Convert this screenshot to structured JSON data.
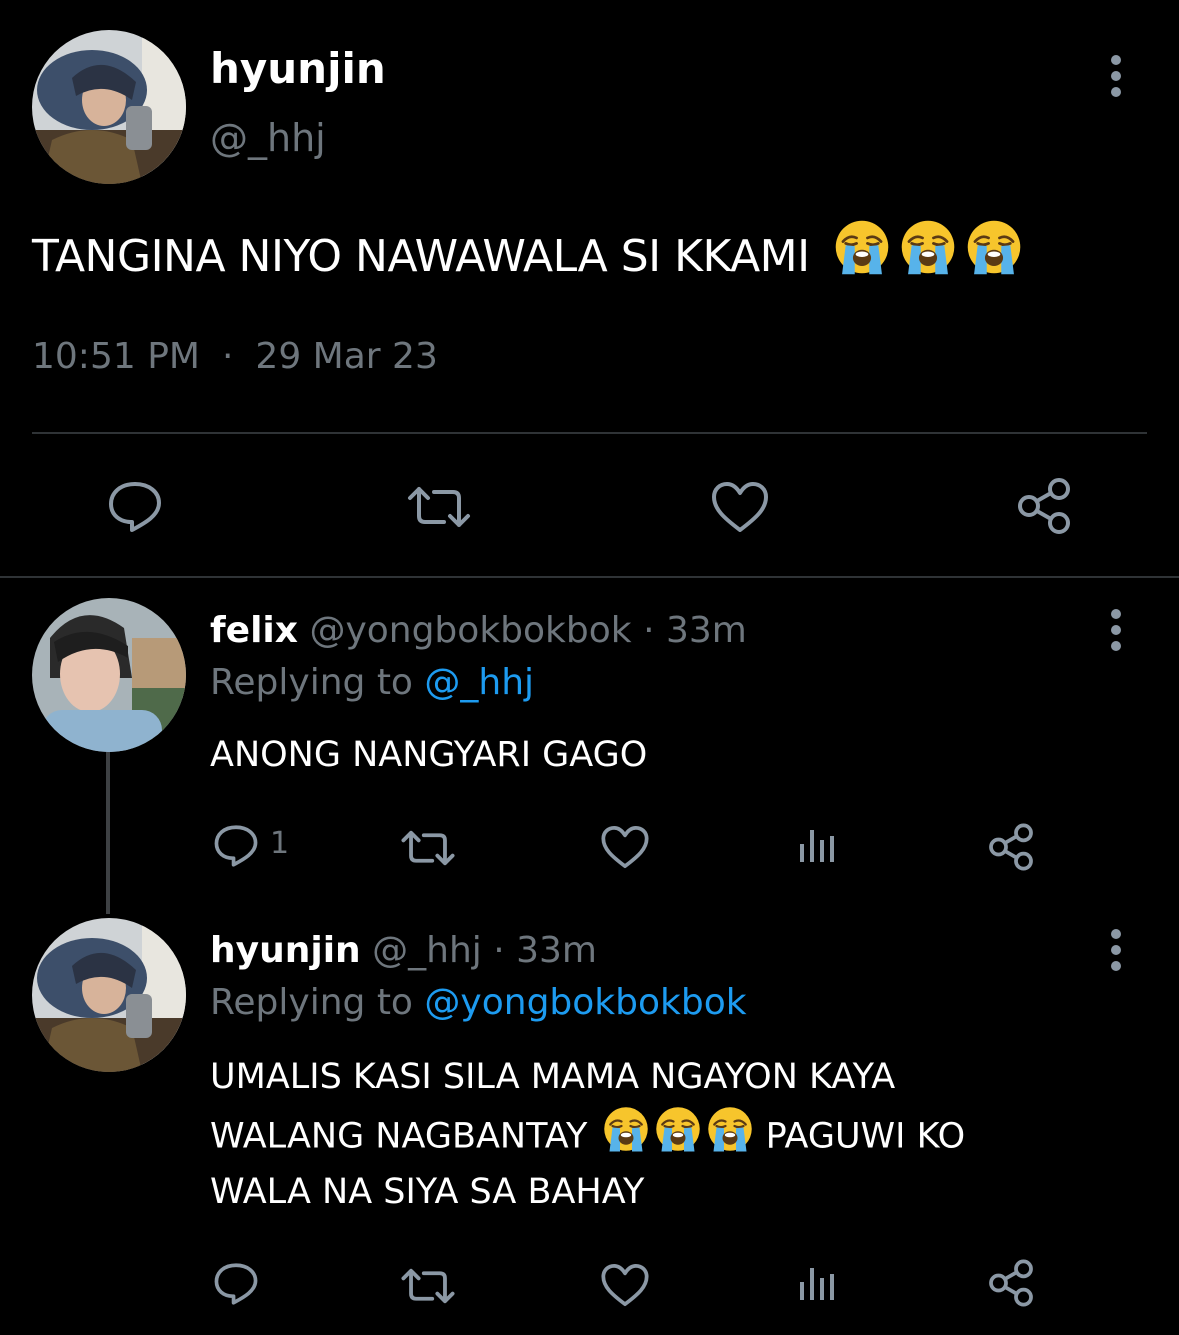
{
  "main_tweet": {
    "author_name": "hyunjin",
    "author_handle": "@_hhj",
    "text": "TANGINA NIYO NAWAWALA SI KKAMI",
    "emoji": "loudly-crying-face x3",
    "time": "10:51 PM",
    "separator": "·",
    "date": "29 Mar 23"
  },
  "replies": [
    {
      "author_name": "felix",
      "author_handle": "@yongbokbokbok",
      "age": "· 33m",
      "replying_label": "Replying to",
      "replying_to": "@_hhj",
      "text_lines": [
        "ANONG NANGYARI GAGO"
      ],
      "reply_count": "1"
    },
    {
      "author_name": "hyunjin",
      "author_handle": "@_hhj",
      "age": "· 33m",
      "replying_label": "Replying to",
      "replying_to": "@yongbokbokbok",
      "text_line1": "UMALIS KASI SILA MAMA NGAYON KAYA",
      "text_line2_a": "WALANG NAGBANTAY",
      "text_line2_b": "PAGUWI KO",
      "text_line3": "WALA NA SIYA SA BAHAY"
    }
  ],
  "icons": {
    "reply": "comment-bubble-icon",
    "retweet": "retweet-icon",
    "like": "heart-icon",
    "share": "share-icon",
    "analytics": "analytics-bars-icon",
    "more": "more-vertical-icon",
    "emoji": "loudly-crying-face-icon"
  },
  "colors": {
    "background": "#000000",
    "text": "#ffffff",
    "muted": "#6e767d",
    "link": "#1d9bf0",
    "divider": "#2f3336"
  }
}
